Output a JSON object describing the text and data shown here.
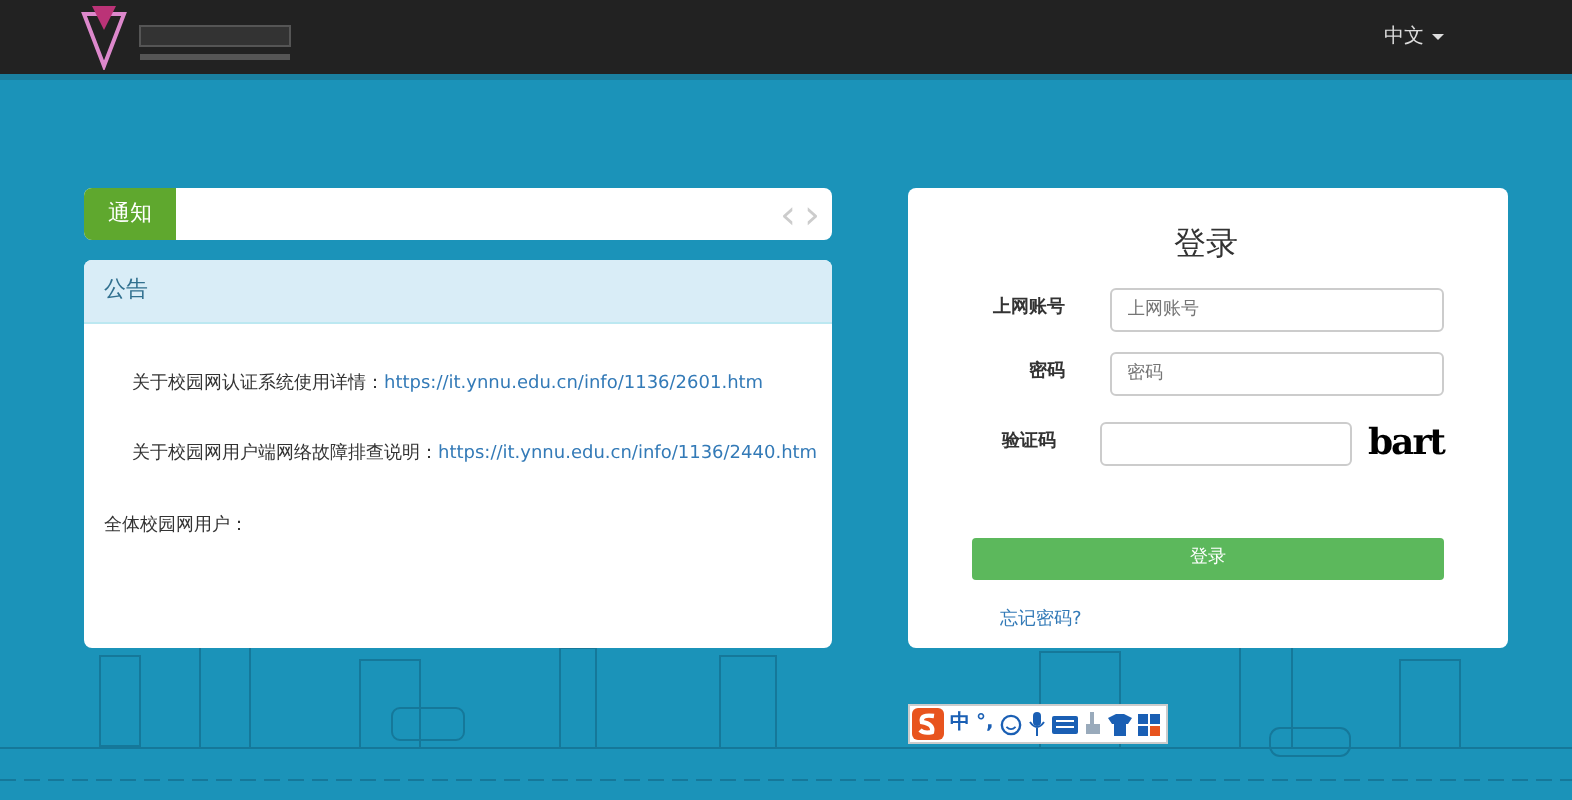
{
  "navbar": {
    "language": "中文"
  },
  "notice_bar": {
    "tab": "通知",
    "prev": "‹",
    "next": "›"
  },
  "announcement": {
    "title": "公告",
    "lines": [
      {
        "kind": "link",
        "text": "关于校园网认证系统使用详情：",
        "url": "https://it.ynnu.edu.cn/info/1136/2601.htm"
      },
      {
        "kind": "link",
        "text": "关于校园网用户端网络故障排查说明：",
        "url": "https://it.ynnu.edu.cn/info/1136/2440.htm"
      },
      {
        "kind": "heading",
        "text": "全体校园网用户："
      }
    ]
  },
  "login": {
    "title": "登录",
    "fields": [
      {
        "label": "上网账号",
        "placeholder": "上网账号",
        "kind": "text"
      },
      {
        "label": "密码",
        "placeholder": "密码",
        "kind": "password"
      },
      {
        "label": "验证码",
        "kind": "captcha",
        "captcha": "bart"
      }
    ],
    "submit": "登录",
    "forgot": "忘记密码?"
  },
  "ime_toolbar": {
    "mode": "中",
    "punct": "°,"
  }
}
